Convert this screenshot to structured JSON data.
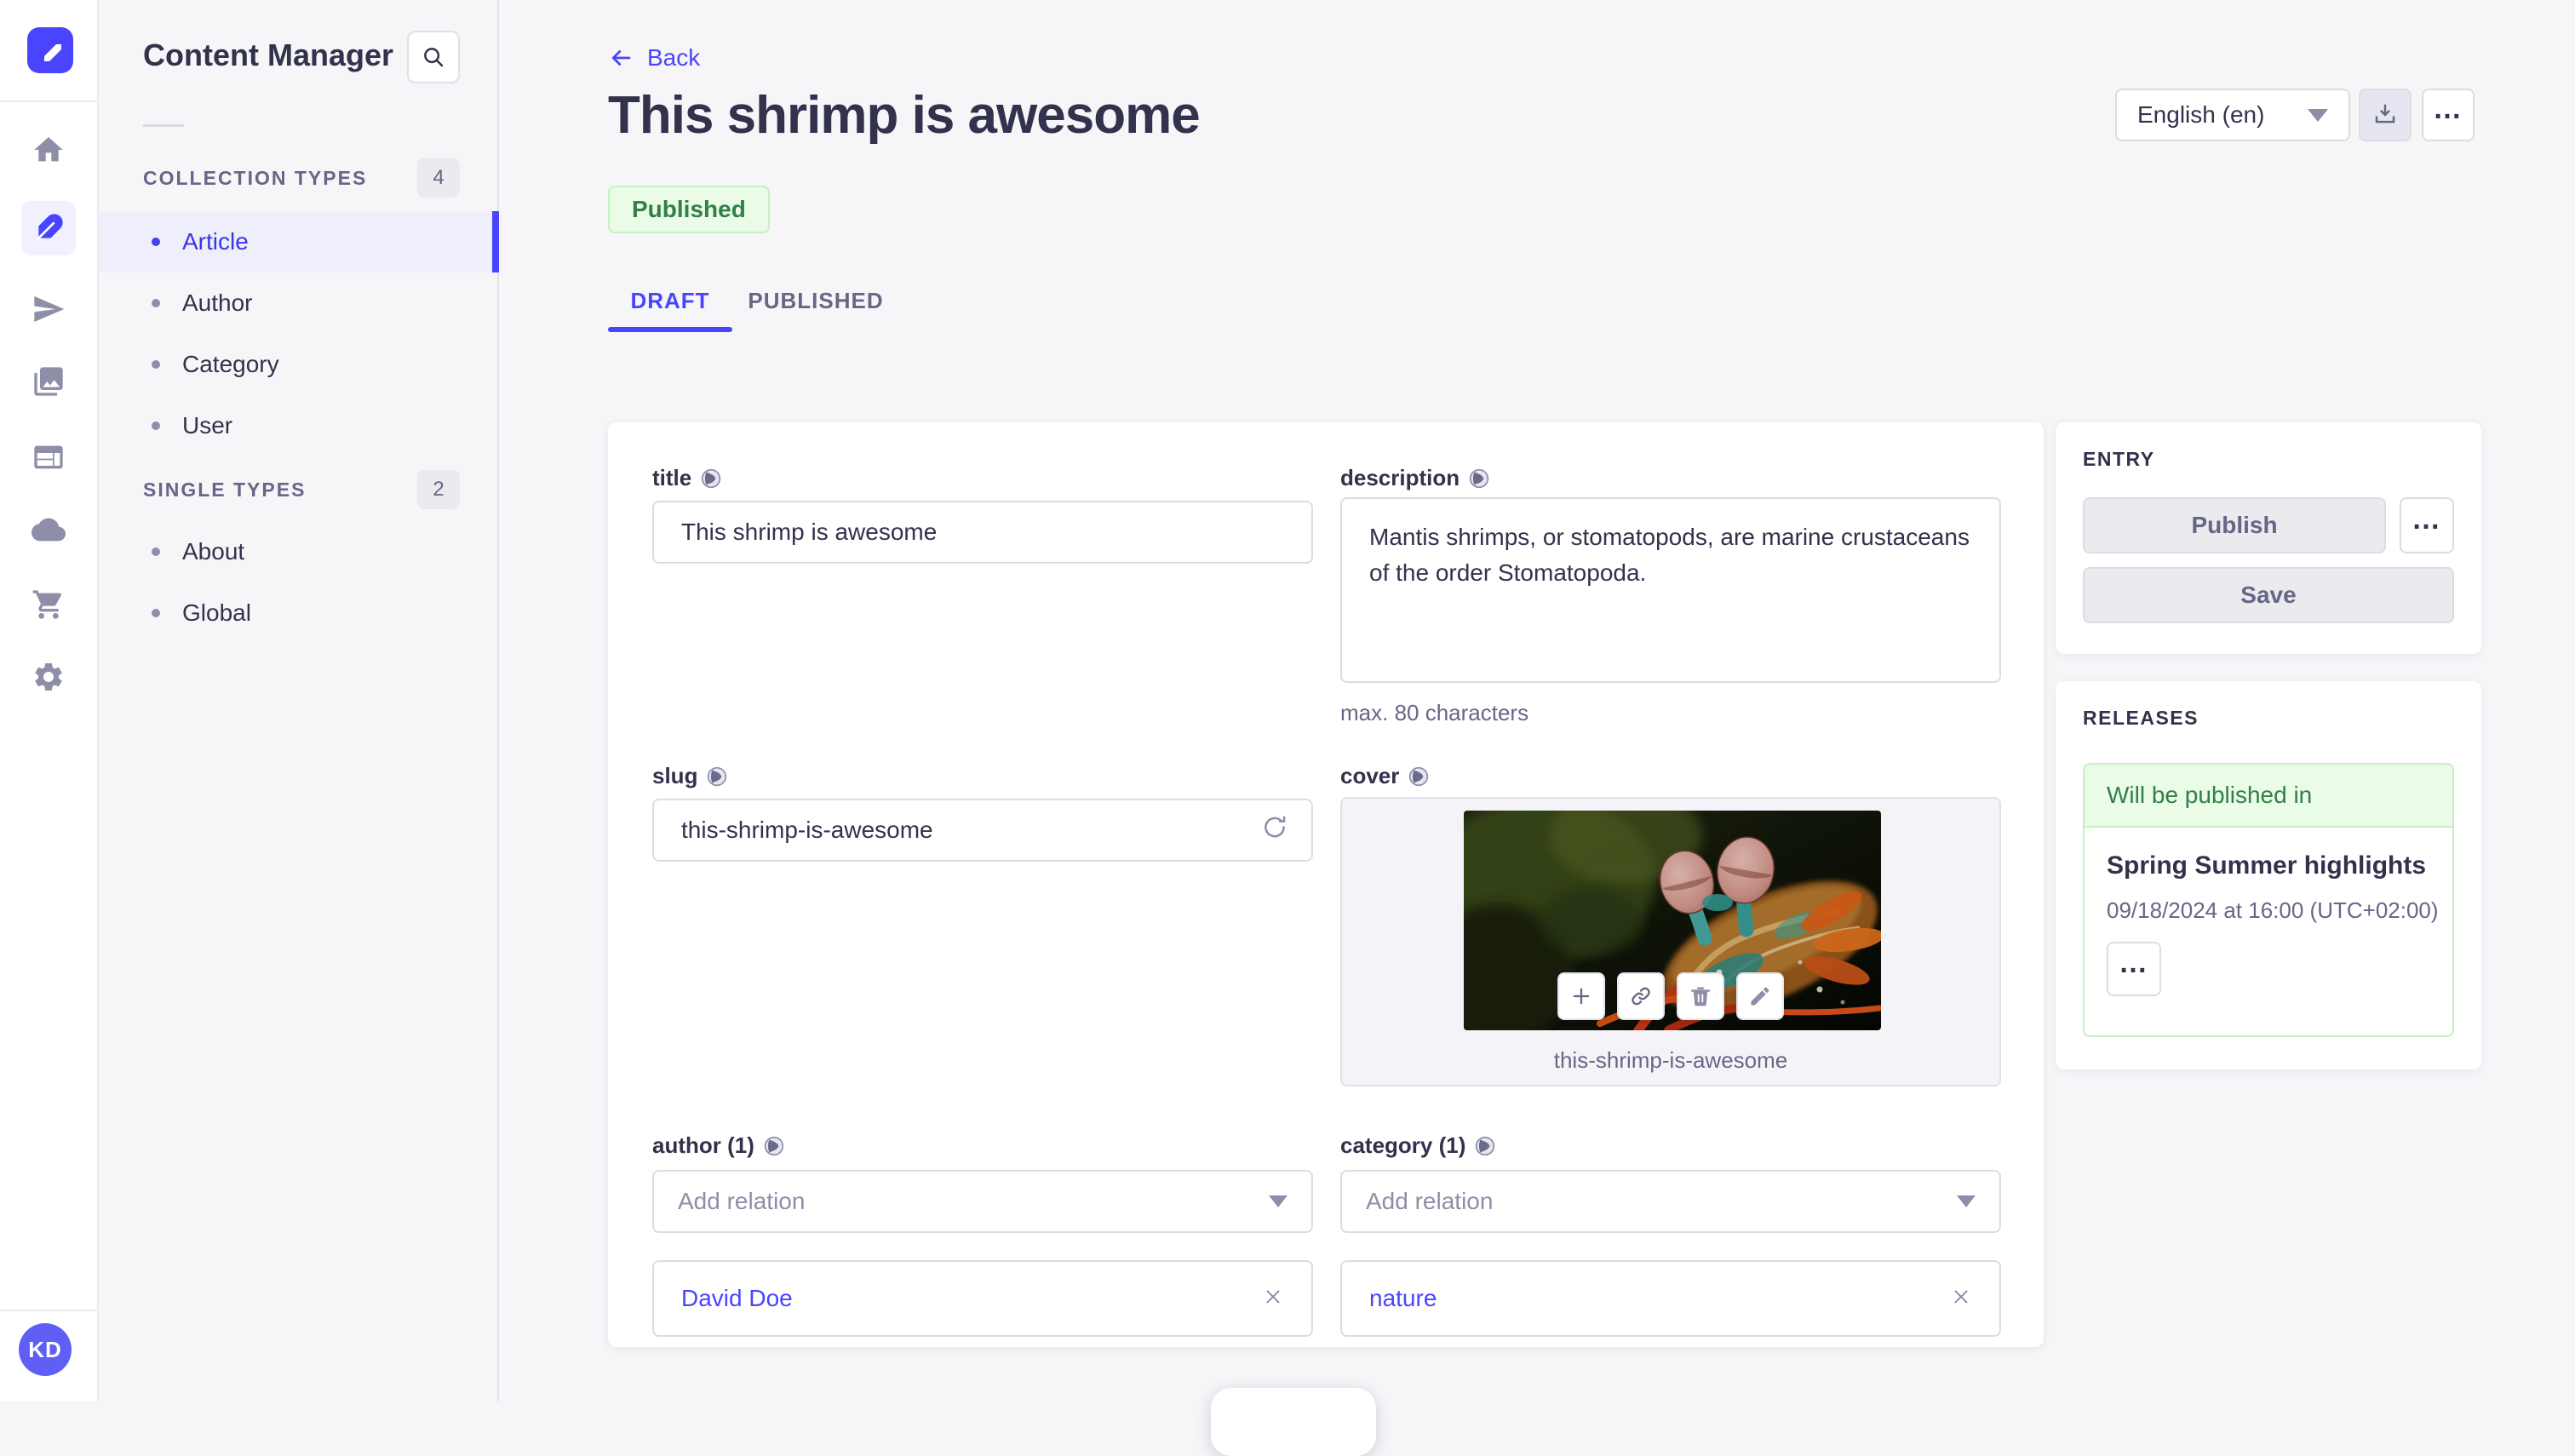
{
  "nav_rail": {
    "logo": "strapi-logo",
    "icons": [
      "home",
      "content-manager-feather",
      "releases-paper-plane",
      "media-library",
      "content-type-builder",
      "cloud",
      "marketplace-cart",
      "settings-gear"
    ],
    "active_icon": "content-manager-feather",
    "avatar_initials": "KD"
  },
  "subnav": {
    "title": "Content Manager",
    "sections": [
      {
        "label": "COLLECTION TYPES",
        "count": "4",
        "items": [
          {
            "label": "Article",
            "active": true
          },
          {
            "label": "Author",
            "active": false
          },
          {
            "label": "Category",
            "active": false
          },
          {
            "label": "User",
            "active": false
          }
        ]
      },
      {
        "label": "SINGLE TYPES",
        "count": "2",
        "items": [
          {
            "label": "About",
            "active": false
          },
          {
            "label": "Global",
            "active": false
          }
        ]
      }
    ]
  },
  "header": {
    "back_label": "Back",
    "title": "This shrimp is awesome",
    "status_badge": "Published",
    "language_selector": "English (en)"
  },
  "tabs": [
    {
      "label": "DRAFT",
      "active": true
    },
    {
      "label": "PUBLISHED",
      "active": false
    }
  ],
  "form": {
    "title_field": {
      "label": "title",
      "value": "This shrimp is awesome"
    },
    "description_field": {
      "label": "description",
      "value": "Mantis shrimps, or stomatopods, are marine crustaceans of the order Stomatopoda.",
      "helper": "max. 80 characters"
    },
    "slug_field": {
      "label": "slug",
      "value": "this-shrimp-is-awesome"
    },
    "cover_field": {
      "label": "cover",
      "filename": "this-shrimp-is-awesome"
    },
    "author_field": {
      "label": "author (1)",
      "placeholder": "Add relation",
      "relations": [
        {
          "name": "David Doe"
        }
      ]
    },
    "category_field": {
      "label": "category (1)",
      "placeholder": "Add relation",
      "relations": [
        {
          "name": "nature"
        }
      ]
    }
  },
  "entry_panel": {
    "heading": "ENTRY",
    "publish_label": "Publish",
    "save_label": "Save"
  },
  "releases_panel": {
    "heading": "RELEASES",
    "status": "Will be published in",
    "release_title": "Spring Summer highlights",
    "release_datetime": "09/18/2024 at 16:00 (UTC+02:00)"
  },
  "colors": {
    "primary": "#4945ff",
    "success_bg": "#eafbe7",
    "success_border": "#c6f0c2",
    "success_text": "#328048",
    "text_dark": "#32324d",
    "text_muted": "#666687",
    "border": "#dcdce4",
    "bg": "#f6f6f9"
  }
}
